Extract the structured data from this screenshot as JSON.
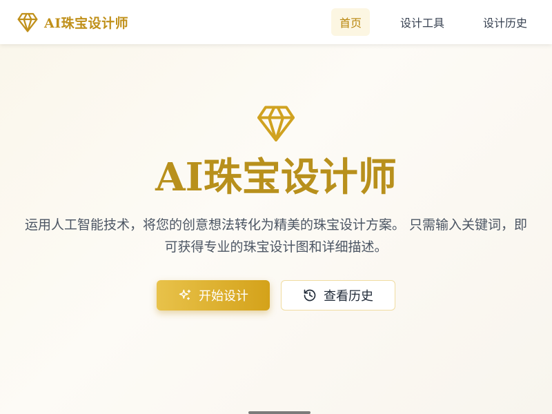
{
  "nav": {
    "brand": "AI珠宝设计师",
    "brand_icon": "gem-icon",
    "links": [
      {
        "label": "首页",
        "active": true
      },
      {
        "label": "设计工具",
        "active": false
      },
      {
        "label": "设计历史",
        "active": false
      }
    ]
  },
  "hero": {
    "icon": "gem-icon",
    "title": "AI珠宝设计师",
    "description_line1": "运用人工智能技术，将您的创意想法转化为精美的珠宝设计方案。 只需输入关键词，即",
    "description_line2": "可获得专业的珠宝设计图和详细描述。",
    "primary_button": {
      "label": "开始设计",
      "icon": "sparkles-icon"
    },
    "secondary_button": {
      "label": "查看历史",
      "icon": "history-icon"
    }
  },
  "colors": {
    "accent": "#c0901a",
    "accent_light": "#e8c24a",
    "accent_dark": "#d4a21a",
    "active_nav_bg": "#fcf6e2"
  }
}
